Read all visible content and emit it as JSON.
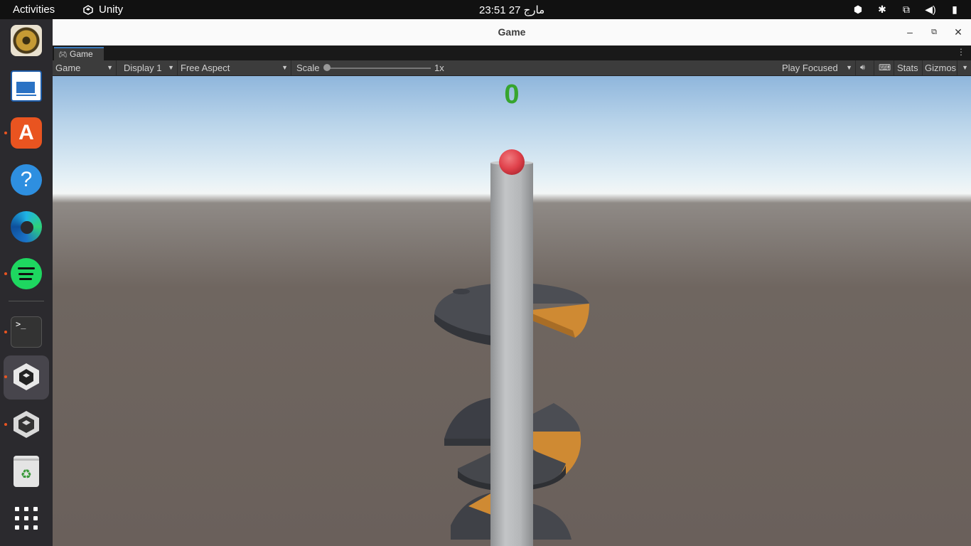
{
  "topbar": {
    "activities": "Activities",
    "app_name": "Unity",
    "clock": "مارج 27  23:51",
    "tray_icons": [
      "unity-icon",
      "weather-icon",
      "network-icon",
      "volume-icon",
      "battery-icon"
    ]
  },
  "dock": {
    "items": [
      {
        "name": "rhythmbox-icon"
      },
      {
        "name": "libreoffice-writer-icon"
      },
      {
        "name": "app-center-icon"
      },
      {
        "name": "help-icon"
      },
      {
        "name": "edge-icon"
      },
      {
        "name": "spotify-icon"
      },
      {
        "name": "terminal-icon"
      },
      {
        "name": "unity-hub-icon"
      },
      {
        "name": "unity-icon"
      },
      {
        "name": "trash-icon"
      },
      {
        "name": "show-apps-icon"
      }
    ]
  },
  "window": {
    "title": "Game",
    "tab_label": "Game",
    "toolbar": {
      "view_dropdown": "Game",
      "display_dropdown": "Display 1",
      "aspect_dropdown": "Free Aspect",
      "scale_label": "Scale",
      "scale_value": "1x",
      "play_mode_dropdown": "Play Focused",
      "stats_label": "Stats",
      "gizmos_label": "Gizmos"
    }
  },
  "game": {
    "score": "0"
  },
  "colors": {
    "accent_orange": "#e95420",
    "score_green": "#37a52e",
    "platform_dark": "#4a4c52",
    "platform_orange": "#cf8a33",
    "ball_red": "#e2404a",
    "pillar_gray": "#b9bbbd"
  }
}
